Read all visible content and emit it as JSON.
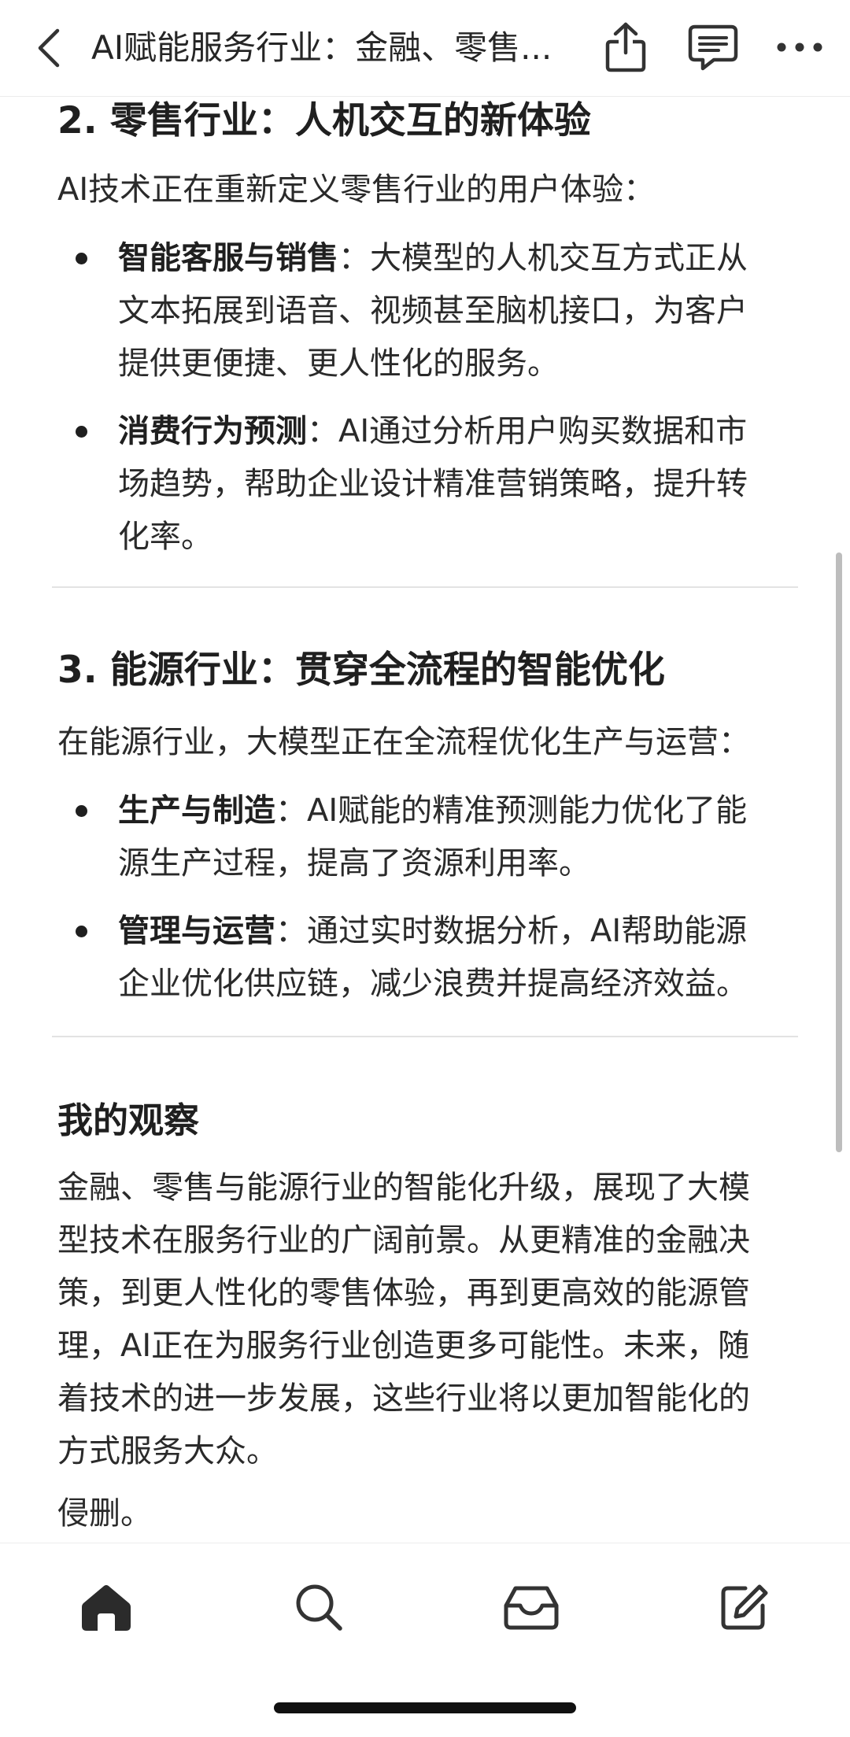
{
  "topbar": {
    "title": "AI赋能服务行业：金融、零售..."
  },
  "icons": {
    "back": "chevron-left-icon",
    "share": "share-icon",
    "comment": "comment-icon",
    "more": "more-icon",
    "home": "home-icon",
    "search": "search-icon",
    "inbox": "inbox-icon",
    "compose": "compose-icon"
  },
  "colors": {
    "text": "#262626",
    "heading": "#1f1f1f",
    "divider": "#e3e3e3",
    "icon": "#333333"
  },
  "article": {
    "retail": {
      "heading": "2. 零售行业：人机交互的新体验",
      "intro": "AI技术正在重新定义零售行业的用户体验：",
      "items": [
        {
          "title": "智能客服与销售",
          "sep": "：",
          "line1": "大模型的人机交互方式正从",
          "line2": "文本拓展到语音、视频甚至脑机接口，为客户",
          "line3": "提供更便捷、更人性化的服务。"
        },
        {
          "title": "消费行为预测",
          "sep": "：",
          "line1": "AI通过分析用户购买数据和市",
          "line2": "场趋势，帮助企业设计精准营销策略，提升转",
          "line3": "化率。"
        }
      ]
    },
    "energy": {
      "heading": "3. 能源行业：贯穿全流程的智能优化",
      "intro": "在能源行业，大模型正在全流程优化生产与运营：",
      "items": [
        {
          "title": "生产与制造",
          "sep": "：",
          "line1": "AI赋能的精准预测能力优化了能",
          "line2": "源生产过程，提高了资源利用率。"
        },
        {
          "title": "管理与运营",
          "sep": "：",
          "line1": "通过实时数据分析，AI帮助能源",
          "line2": "企业优化供应链，减少浪费并提高经济效益。"
        }
      ]
    },
    "observation": {
      "heading": "我的观察",
      "lines": [
        "金融、零售与能源行业的智能化升级，展现了大模",
        "型技术在服务行业的广阔前景。从更精准的金融决",
        "策，到更人性化的零售体验，再到更高效的能源管",
        "理，AI正在为服务行业创造更多可能性。未来，随",
        "着技术的进一步发展，这些行业将以更加智能化的",
        "方式服务大众。"
      ],
      "footer": "侵删。"
    }
  }
}
